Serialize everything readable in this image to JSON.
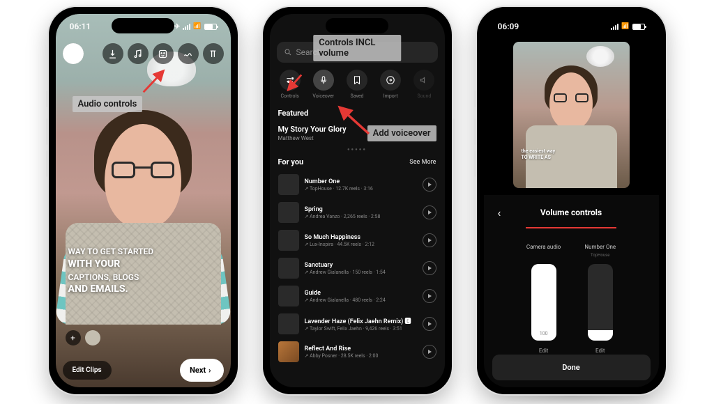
{
  "phone1": {
    "time": "06:11",
    "annotation": "Audio controls",
    "overlay_line1": "WAY TO GET STARTED",
    "overlay_line2": "WITH YOUR",
    "overlay_line3": "CAPTIONS, BLOGS",
    "overlay_line4": "AND EMAILS.",
    "edit_clips": "Edit Clips",
    "next": "Next"
  },
  "phone2": {
    "annotation_top": "Controls INCL volume",
    "annotation_voiceover": "Add voiceover",
    "search_placeholder": "Search music",
    "tabs": [
      {
        "label": "Controls"
      },
      {
        "label": "Voiceover"
      },
      {
        "label": "Saved"
      },
      {
        "label": "Import"
      },
      {
        "label": "Sound"
      }
    ],
    "featured_header": "Featured",
    "featured_title": "My Story Your Glory",
    "featured_artist": "Matthew West",
    "for_you": "For you",
    "see_more": "See More",
    "songs": [
      {
        "title": "Number One",
        "meta": "↗ TopHouse · 12.7K reels · 3:16"
      },
      {
        "title": "Spring",
        "meta": "↗ Andrea Vanzo · 2,265 reels · 2:58"
      },
      {
        "title": "So Much Happiness",
        "meta": "↗ Lux-Inspira · 44.5K reels · 2:12"
      },
      {
        "title": "Sanctuary",
        "meta": "↗ Andrew Gialanella · 150 reels · 1:54"
      },
      {
        "title": "Guide",
        "meta": "↗ Andrew Gialanella · 480 reels · 2:24"
      },
      {
        "title": "Lavender Haze (Felix Jaehn Remix) 🅴",
        "meta": "↗ Taylor Swift, Felix Jaehn · 9,426 reels · 3:51"
      },
      {
        "title": "Reflect And Rise",
        "meta": "↗ Abby Posner · 28.5K reels · 2:00"
      }
    ]
  },
  "phone3": {
    "time": "06:09",
    "preview_text1": "the easiest way",
    "preview_text2": "TO WRITE AS",
    "volume_title": "Volume controls",
    "slider1_label": "Camera audio",
    "slider1_sub": "",
    "slider1_val": "100",
    "slider2_label": "Number One",
    "slider2_sub": "TopHouse",
    "slider2_val": "",
    "edit": "Edit",
    "done": "Done"
  }
}
